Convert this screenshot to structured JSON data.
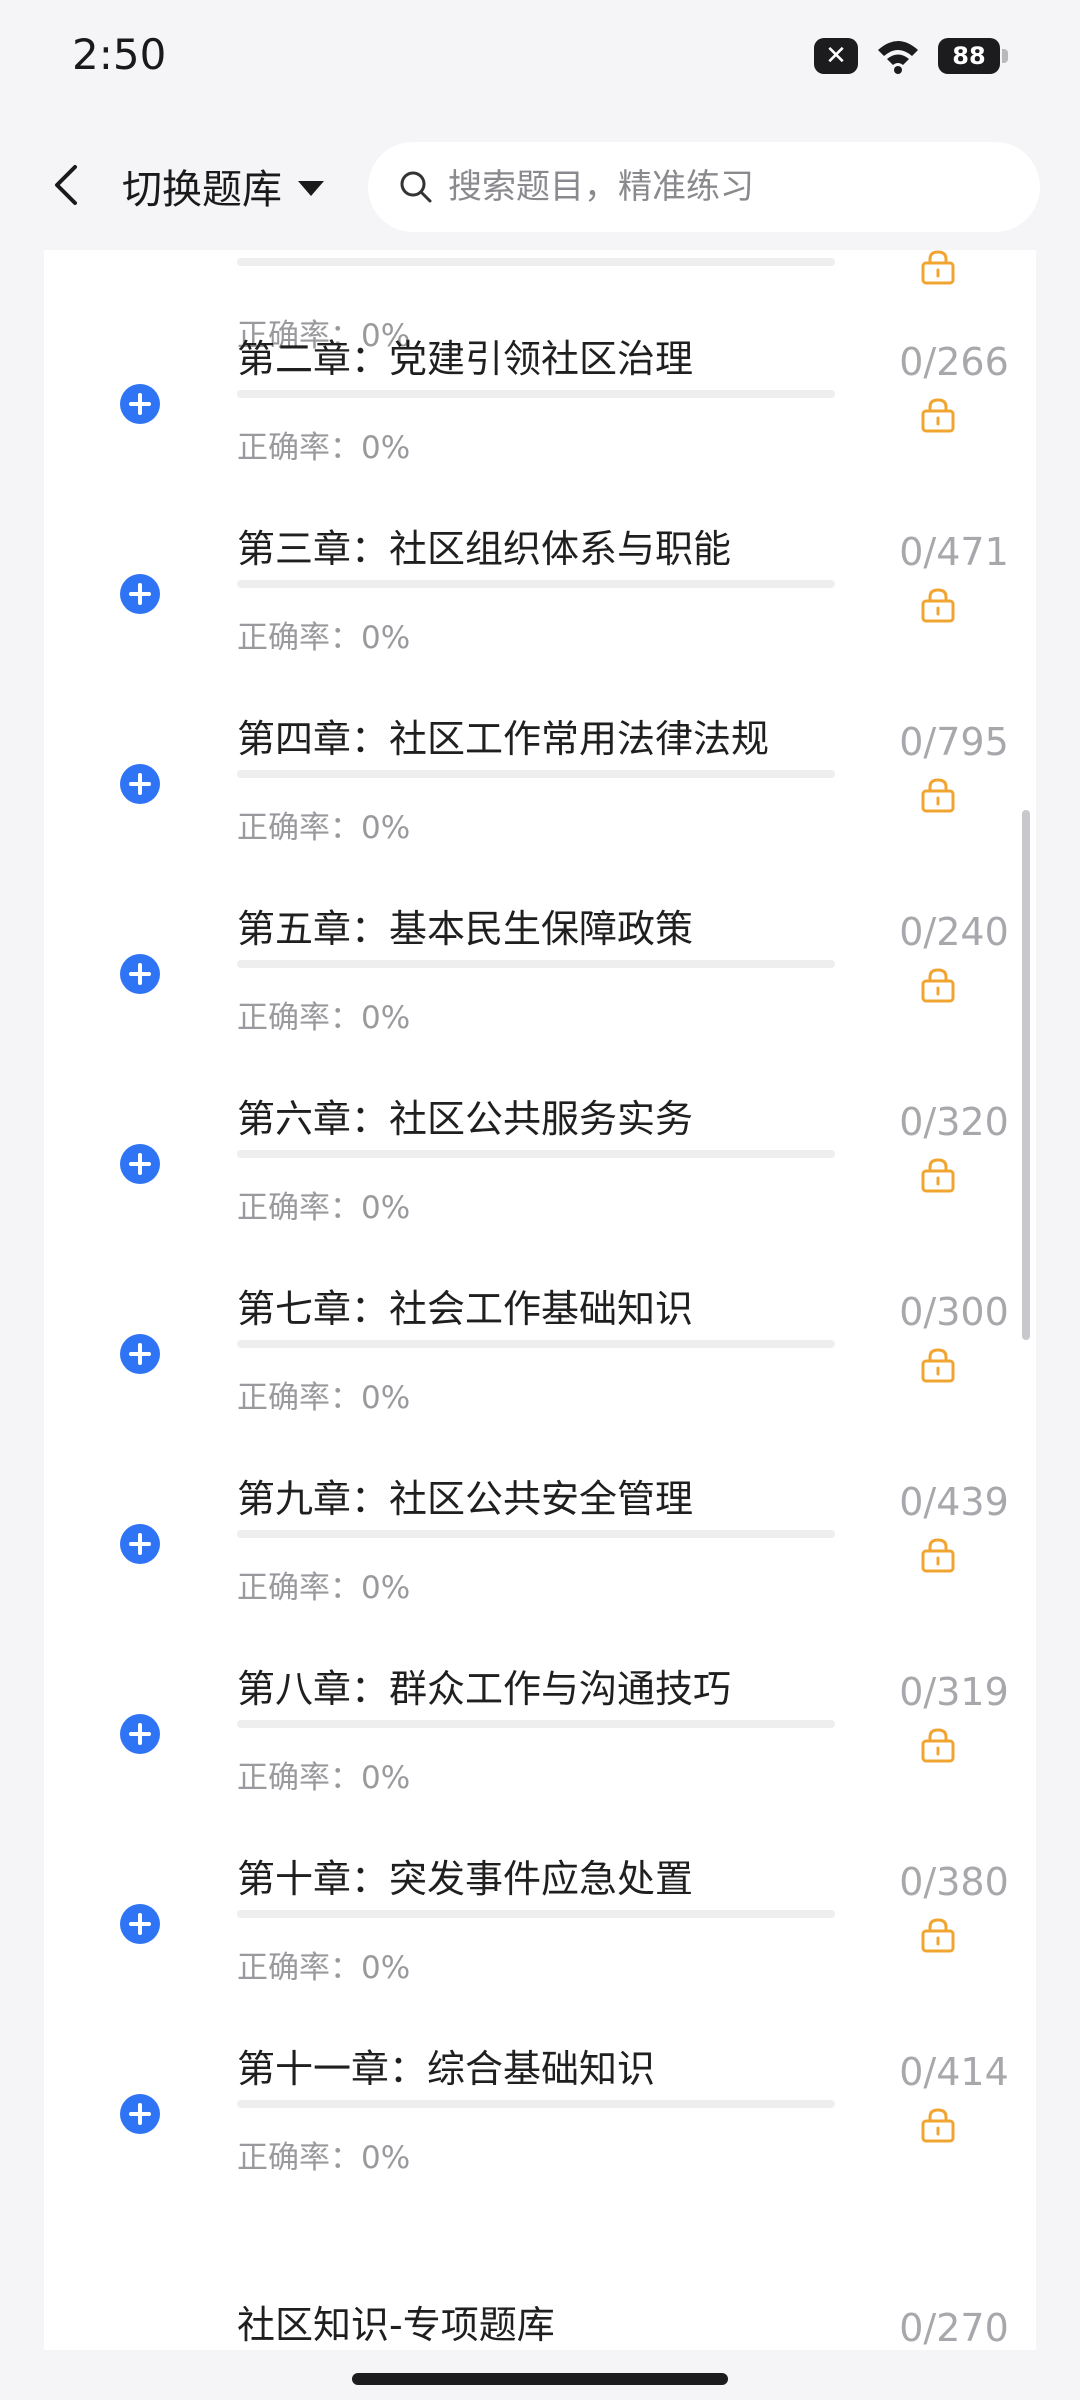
{
  "status_bar": {
    "time": "2:50",
    "battery": "88",
    "icons": [
      "notification-x-icon",
      "wifi-icon",
      "battery-icon"
    ]
  },
  "header": {
    "switch_label": "切换题库",
    "search_placeholder": "搜索题目，精准练习"
  },
  "colors": {
    "accent": "#2f74f5",
    "lock": "#f0a531",
    "muted": "#9a9a9e"
  },
  "top_partial_row": {
    "accuracy": "正确率：0%"
  },
  "chapters": [
    {
      "title": "第二章：党建引领社区治理",
      "accuracy": "正确率：0%",
      "count": "0/266",
      "progress": 0
    },
    {
      "title": "第三章：社区组织体系与职能",
      "accuracy": "正确率：0%",
      "count": "0/471",
      "progress": 0
    },
    {
      "title": "第四章：社区工作常用法律法规",
      "accuracy": "正确率：0%",
      "count": "0/795",
      "progress": 0
    },
    {
      "title": "第五章：基本民生保障政策",
      "accuracy": "正确率：0%",
      "count": "0/240",
      "progress": 0
    },
    {
      "title": "第六章：社区公共服务实务",
      "accuracy": "正确率：0%",
      "count": "0/320",
      "progress": 0
    },
    {
      "title": "第七章：社会工作基础知识",
      "accuracy": "正确率：0%",
      "count": "0/300",
      "progress": 0
    },
    {
      "title": "第九章：社区公共安全管理",
      "accuracy": "正确率：0%",
      "count": "0/439",
      "progress": 0
    },
    {
      "title": "第八章：群众工作与沟通技巧",
      "accuracy": "正确率：0%",
      "count": "0/319",
      "progress": 0
    },
    {
      "title": "第十章：突发事件应急处置",
      "accuracy": "正确率：0%",
      "count": "0/380",
      "progress": 0
    },
    {
      "title": "第十一章：综合基础知识",
      "accuracy": "正确率：0%",
      "count": "0/414",
      "progress": 0
    }
  ],
  "bottom_partial_row": {
    "title": "社区知识-专项题库",
    "count": "0/270"
  }
}
